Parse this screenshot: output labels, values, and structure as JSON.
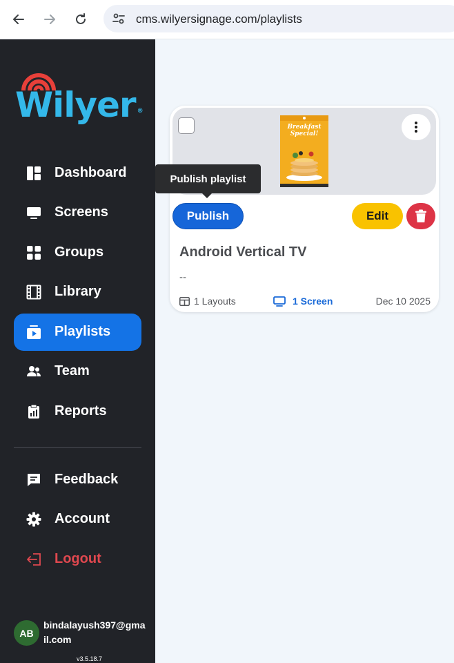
{
  "browser": {
    "url": "cms.wilyersignage.com/playlists"
  },
  "logo": {
    "text": "Wilyer",
    "registered": "®",
    "color": "#34b8ea",
    "arc_color": "#e8403a"
  },
  "sidebar": {
    "items": [
      {
        "label": "Dashboard",
        "icon": "dashboard-icon"
      },
      {
        "label": "Screens",
        "icon": "monitor-icon"
      },
      {
        "label": "Groups",
        "icon": "grid-icon"
      },
      {
        "label": "Library",
        "icon": "film-icon"
      },
      {
        "label": "Playlists",
        "icon": "playlist-icon",
        "active": true
      },
      {
        "label": "Team",
        "icon": "team-icon"
      },
      {
        "label": "Reports",
        "icon": "clipboard-icon"
      }
    ],
    "bottom_items": [
      {
        "label": "Feedback",
        "icon": "feedback-icon"
      },
      {
        "label": "Account",
        "icon": "gear-icon"
      },
      {
        "label": "Logout",
        "icon": "logout-icon"
      }
    ],
    "user": {
      "initials": "AB",
      "email": "bindalayush397@gmail.com"
    },
    "version": "v3.5.18.7"
  },
  "playlist_card": {
    "title": "Android Vertical TV",
    "description": "--",
    "layouts": "1 Layouts",
    "screens": "1 Screen",
    "date": "Dec 10 2025",
    "publish_label": "Publish",
    "edit_label": "Edit",
    "poster_text": "Breakfast Special!"
  },
  "tooltip": {
    "text": "Publish playlist"
  },
  "colors": {
    "sidebar_bg": "#212328",
    "active_blue": "#1473e6",
    "publish_blue": "#1666d9",
    "edit_yellow": "#f9c200",
    "delete_red": "#dd3446",
    "logout_red": "#e0484f",
    "page_bg": "#f1f6fb"
  }
}
